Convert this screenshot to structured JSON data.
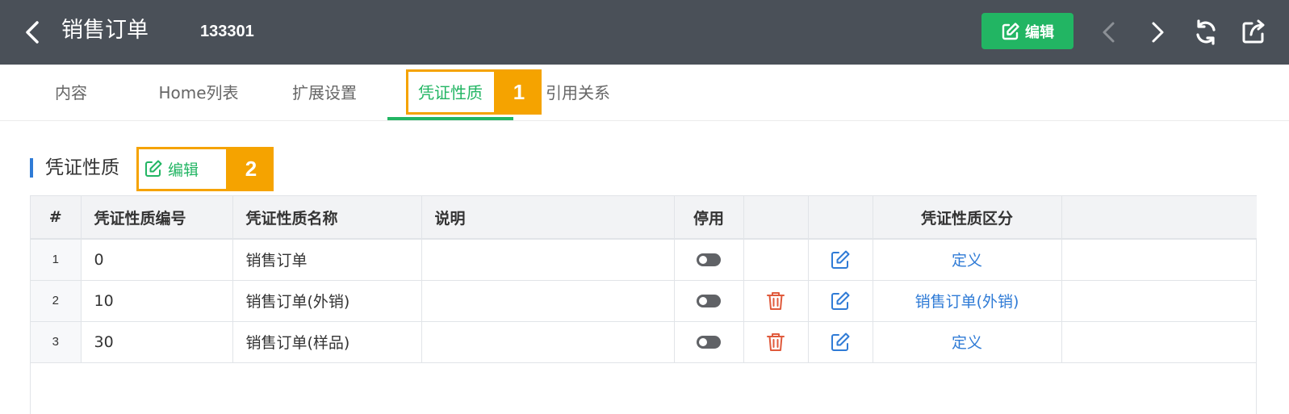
{
  "header": {
    "title": "销售订单",
    "doc_no": "133301",
    "edit_label": "编辑",
    "bg_color": "#4a5058",
    "accent": "#22b563"
  },
  "tabs": [
    {
      "label": "内容",
      "active": false
    },
    {
      "label": "Home列表",
      "active": false
    },
    {
      "label": "扩展设置",
      "active": false
    },
    {
      "label": "凭证性质",
      "active": true
    },
    {
      "label": "引用关系",
      "active": false
    }
  ],
  "annotations": {
    "first": "1",
    "second": "2"
  },
  "section": {
    "title": "凭证性质",
    "edit_label": "编辑"
  },
  "table": {
    "columns": [
      "#",
      "凭证性质编号",
      "凭证性质名称",
      "说明",
      "停用",
      "",
      "",
      "凭证性质区分",
      ""
    ],
    "rows": [
      {
        "idx": "1",
        "code": "0",
        "name": "销售订单",
        "desc": "",
        "disabled": false,
        "deletable": false,
        "category": "定义"
      },
      {
        "idx": "2",
        "code": "10",
        "name": "销售订单(外销)",
        "desc": "",
        "disabled": false,
        "deletable": true,
        "category": "销售订单(外销)"
      },
      {
        "idx": "3",
        "code": "30",
        "name": "销售订单(样品)",
        "desc": "",
        "disabled": false,
        "deletable": true,
        "category": "定义"
      }
    ]
  },
  "icons": {
    "back": "chevron-left-icon",
    "edit": "edit-icon",
    "prev": "chevron-left-icon",
    "next": "chevron-right-icon",
    "refresh": "refresh-icon",
    "share": "share-icon",
    "delete": "trash-icon"
  }
}
